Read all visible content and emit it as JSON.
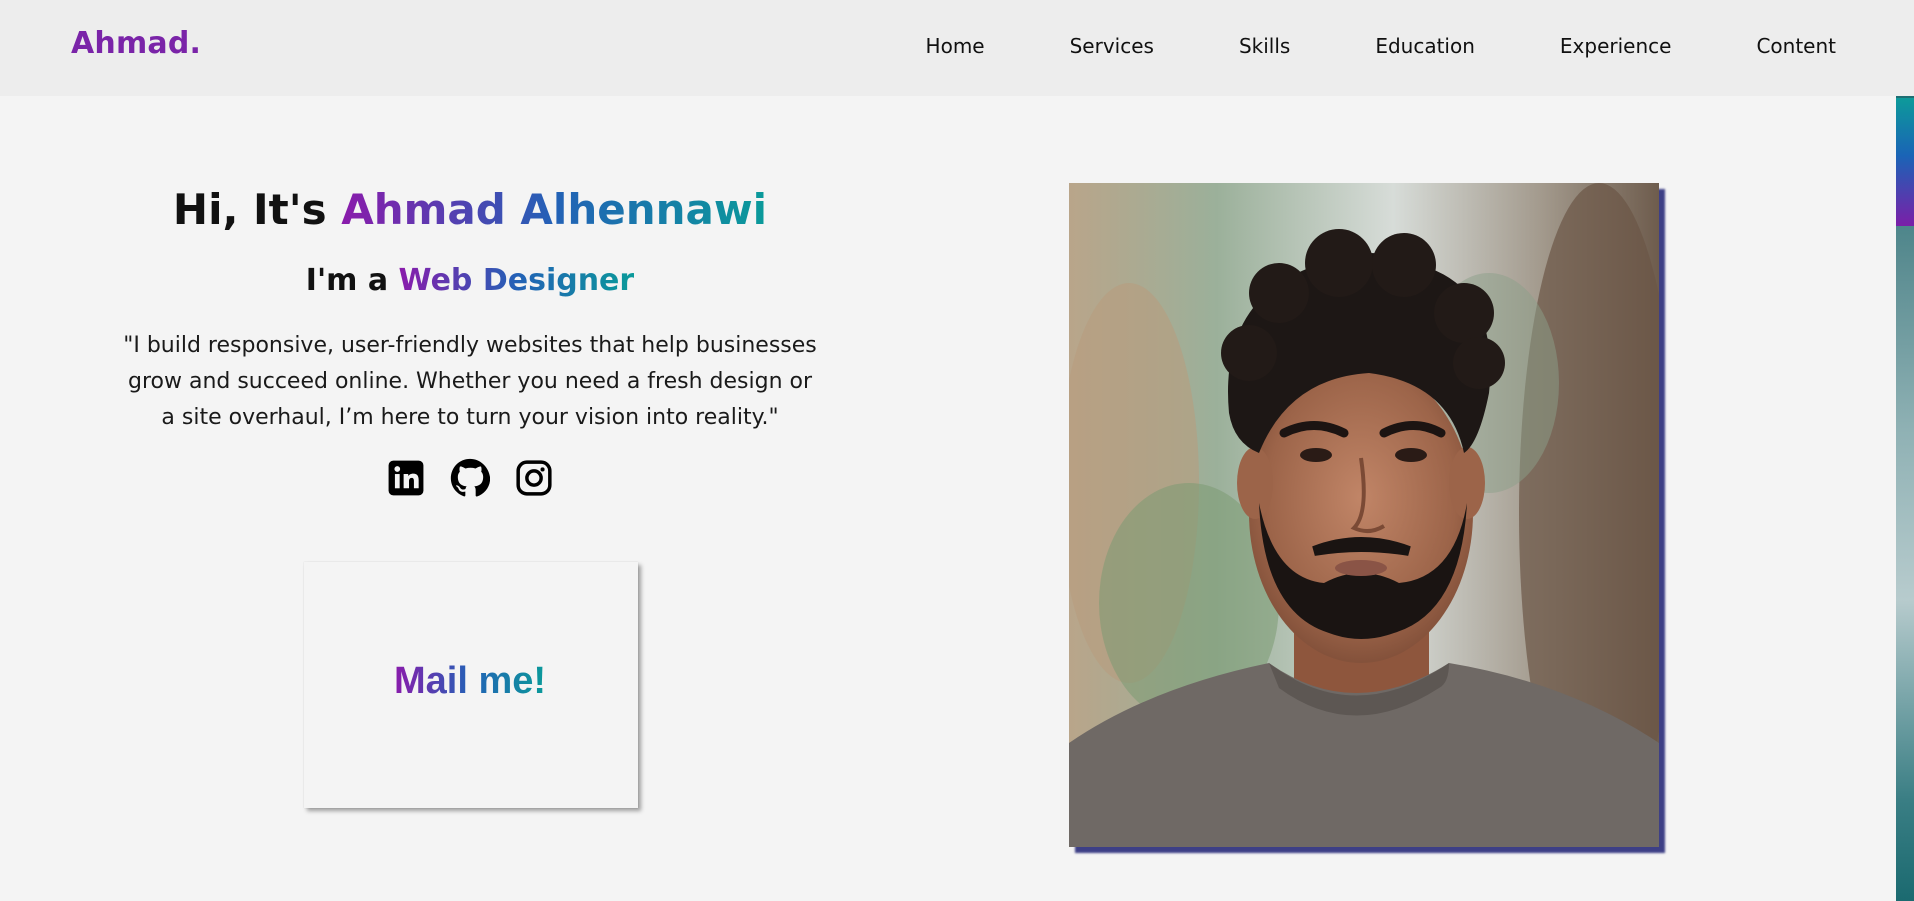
{
  "brand": {
    "logo": "Ahmad.",
    "accent": "#7a24a8",
    "gradient": [
      "#8a1bab",
      "#2361b6",
      "#0a9a9a"
    ]
  },
  "nav": {
    "items": [
      {
        "label": "Home"
      },
      {
        "label": "Services"
      },
      {
        "label": "Skills"
      },
      {
        "label": "Education"
      },
      {
        "label": "Experience"
      },
      {
        "label": "Content"
      }
    ]
  },
  "hero": {
    "greeting": "Hi, It's ",
    "name": "Ahmad Alhennawi",
    "role_prefix": "I'm a ",
    "role": "Web Designer",
    "intro": "\"I build responsive, user-friendly websites that help businesses grow and succeed online. Whether you need a fresh design or a site overhaul, I’m here to turn your vision into reality.\"",
    "socials": [
      {
        "icon": "linkedin-icon"
      },
      {
        "icon": "github-icon"
      },
      {
        "icon": "instagram-icon"
      }
    ],
    "cta": "Mail me!"
  },
  "portrait": {
    "subject": "profile-photo"
  }
}
